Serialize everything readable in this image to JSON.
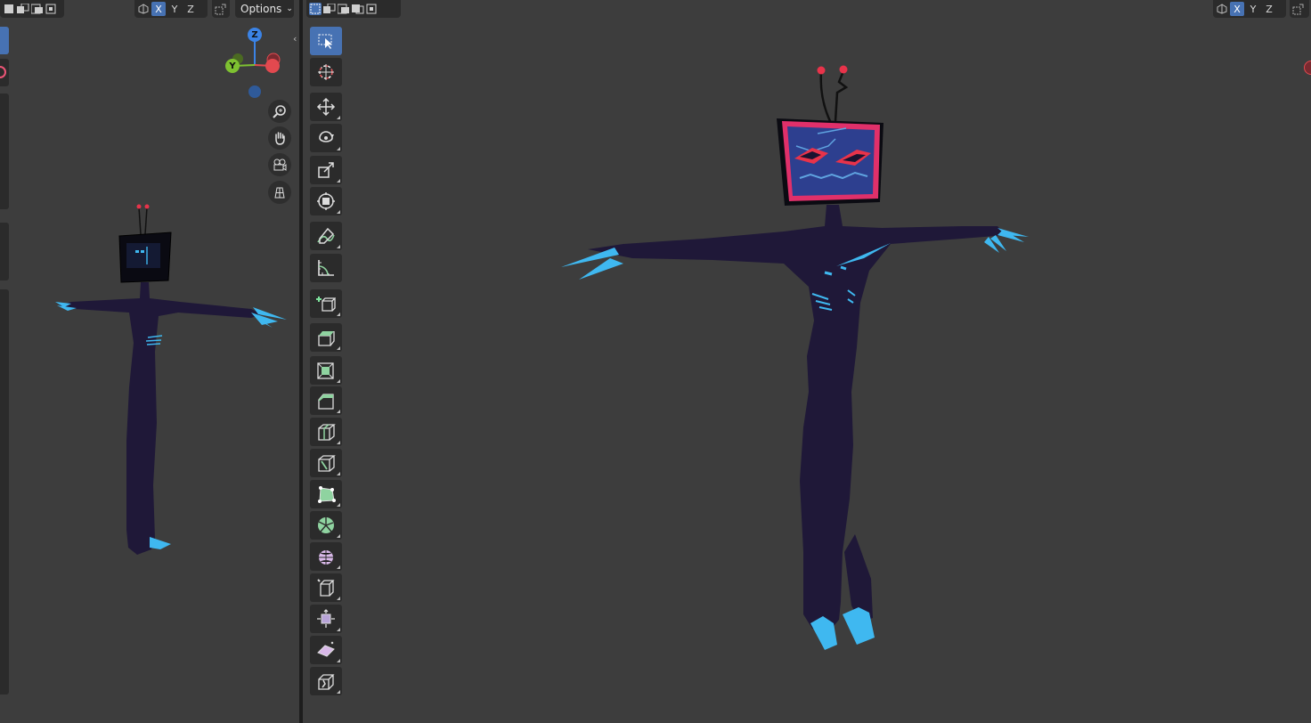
{
  "header": {
    "axis_labels": [
      "X",
      "Y",
      "Z"
    ],
    "options_label": "Options"
  },
  "gizmo": {
    "z_label": "Z",
    "y_label": "Y",
    "x_color": "#e2494f",
    "y_color": "#7ec131",
    "z_color": "#3b83e6"
  },
  "toolbar": {
    "tools": [
      {
        "name": "select-box",
        "icon": "select-box-icon",
        "active": true
      },
      {
        "name": "cursor",
        "icon": "cursor-icon"
      },
      {
        "name": "move",
        "icon": "move-icon"
      },
      {
        "name": "rotate",
        "icon": "rotate-icon"
      },
      {
        "name": "scale",
        "icon": "scale-icon"
      },
      {
        "name": "transform",
        "icon": "transform-icon"
      },
      {
        "name": "annotate",
        "icon": "annotate-icon"
      },
      {
        "name": "measure",
        "icon": "measure-icon"
      },
      {
        "name": "add-cube",
        "icon": "add-cube-icon"
      },
      {
        "name": "extrude-region",
        "icon": "extrude-icon"
      },
      {
        "name": "inset-faces",
        "icon": "inset-icon"
      },
      {
        "name": "bevel",
        "icon": "bevel-icon"
      },
      {
        "name": "loop-cut",
        "icon": "loop-cut-icon"
      },
      {
        "name": "knife",
        "icon": "knife-icon"
      },
      {
        "name": "poly-build",
        "icon": "poly-build-icon"
      },
      {
        "name": "spin",
        "icon": "spin-icon"
      },
      {
        "name": "smooth",
        "icon": "smooth-icon"
      },
      {
        "name": "edge-slide",
        "icon": "edge-slide-icon"
      },
      {
        "name": "shrink-fatten",
        "icon": "shrink-fatten-icon"
      },
      {
        "name": "shear",
        "icon": "shear-icon"
      },
      {
        "name": "rip-region",
        "icon": "rip-region-icon"
      }
    ]
  },
  "colors": {
    "viewport_bg": "#3d3d3d",
    "panel_bg": "#2b2b2b",
    "accent": "#4772b3",
    "body": "#1f1838",
    "claws": "#3fb8f0",
    "tv_frame": "#e0306a",
    "tv_screen": "#2d3f8f"
  }
}
